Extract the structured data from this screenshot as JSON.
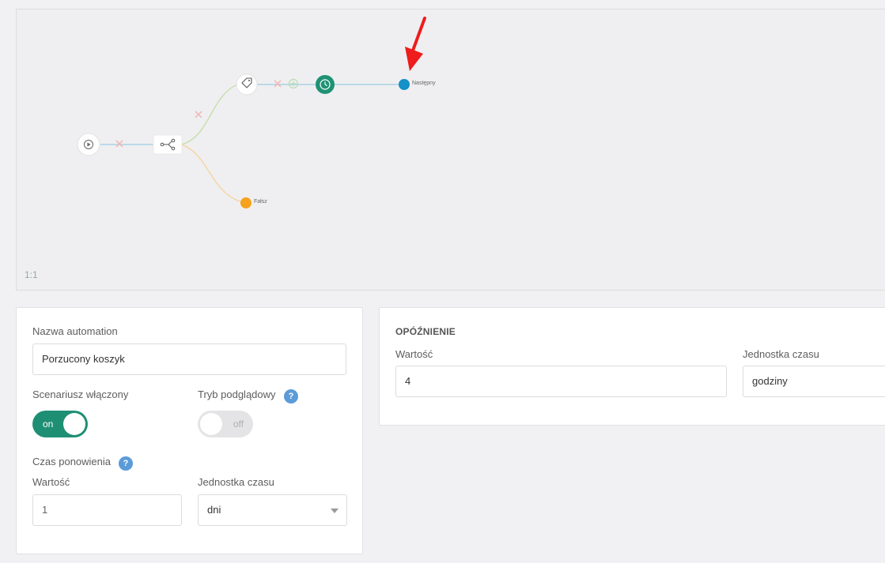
{
  "canvas": {
    "zoom_label": "1:1",
    "next_label": "Następny",
    "false_label": "Fałsz",
    "colors": {
      "line_blue": "#a8d2e6",
      "line_green": "#c9dfae",
      "line_orange": "#f5d5a9",
      "next_dot": "#1590c8",
      "false_dot": "#f6a21c",
      "delay_node": "#1f9275",
      "delete_x": "#f0b4b4",
      "add_plus": "#b9dcae",
      "arrow": "#ee1c1c"
    }
  },
  "automation": {
    "name_label": "Nazwa automation",
    "name_value": "Porzucony koszyk",
    "enabled_label": "Scenariusz włączony",
    "enabled_state": "on",
    "preview_label": "Tryb podglądowy",
    "preview_state": "off",
    "help_glyph": "?",
    "retry_label": "Czas ponowienia",
    "retry_value_label": "Wartość",
    "retry_value": "1",
    "retry_unit_label": "Jednostka czasu",
    "retry_unit": "dni"
  },
  "delay": {
    "title": "OPÓŹNIENIE",
    "value_label": "Wartość",
    "value": "4",
    "unit_label": "Jednostka czasu",
    "unit": "godziny"
  }
}
